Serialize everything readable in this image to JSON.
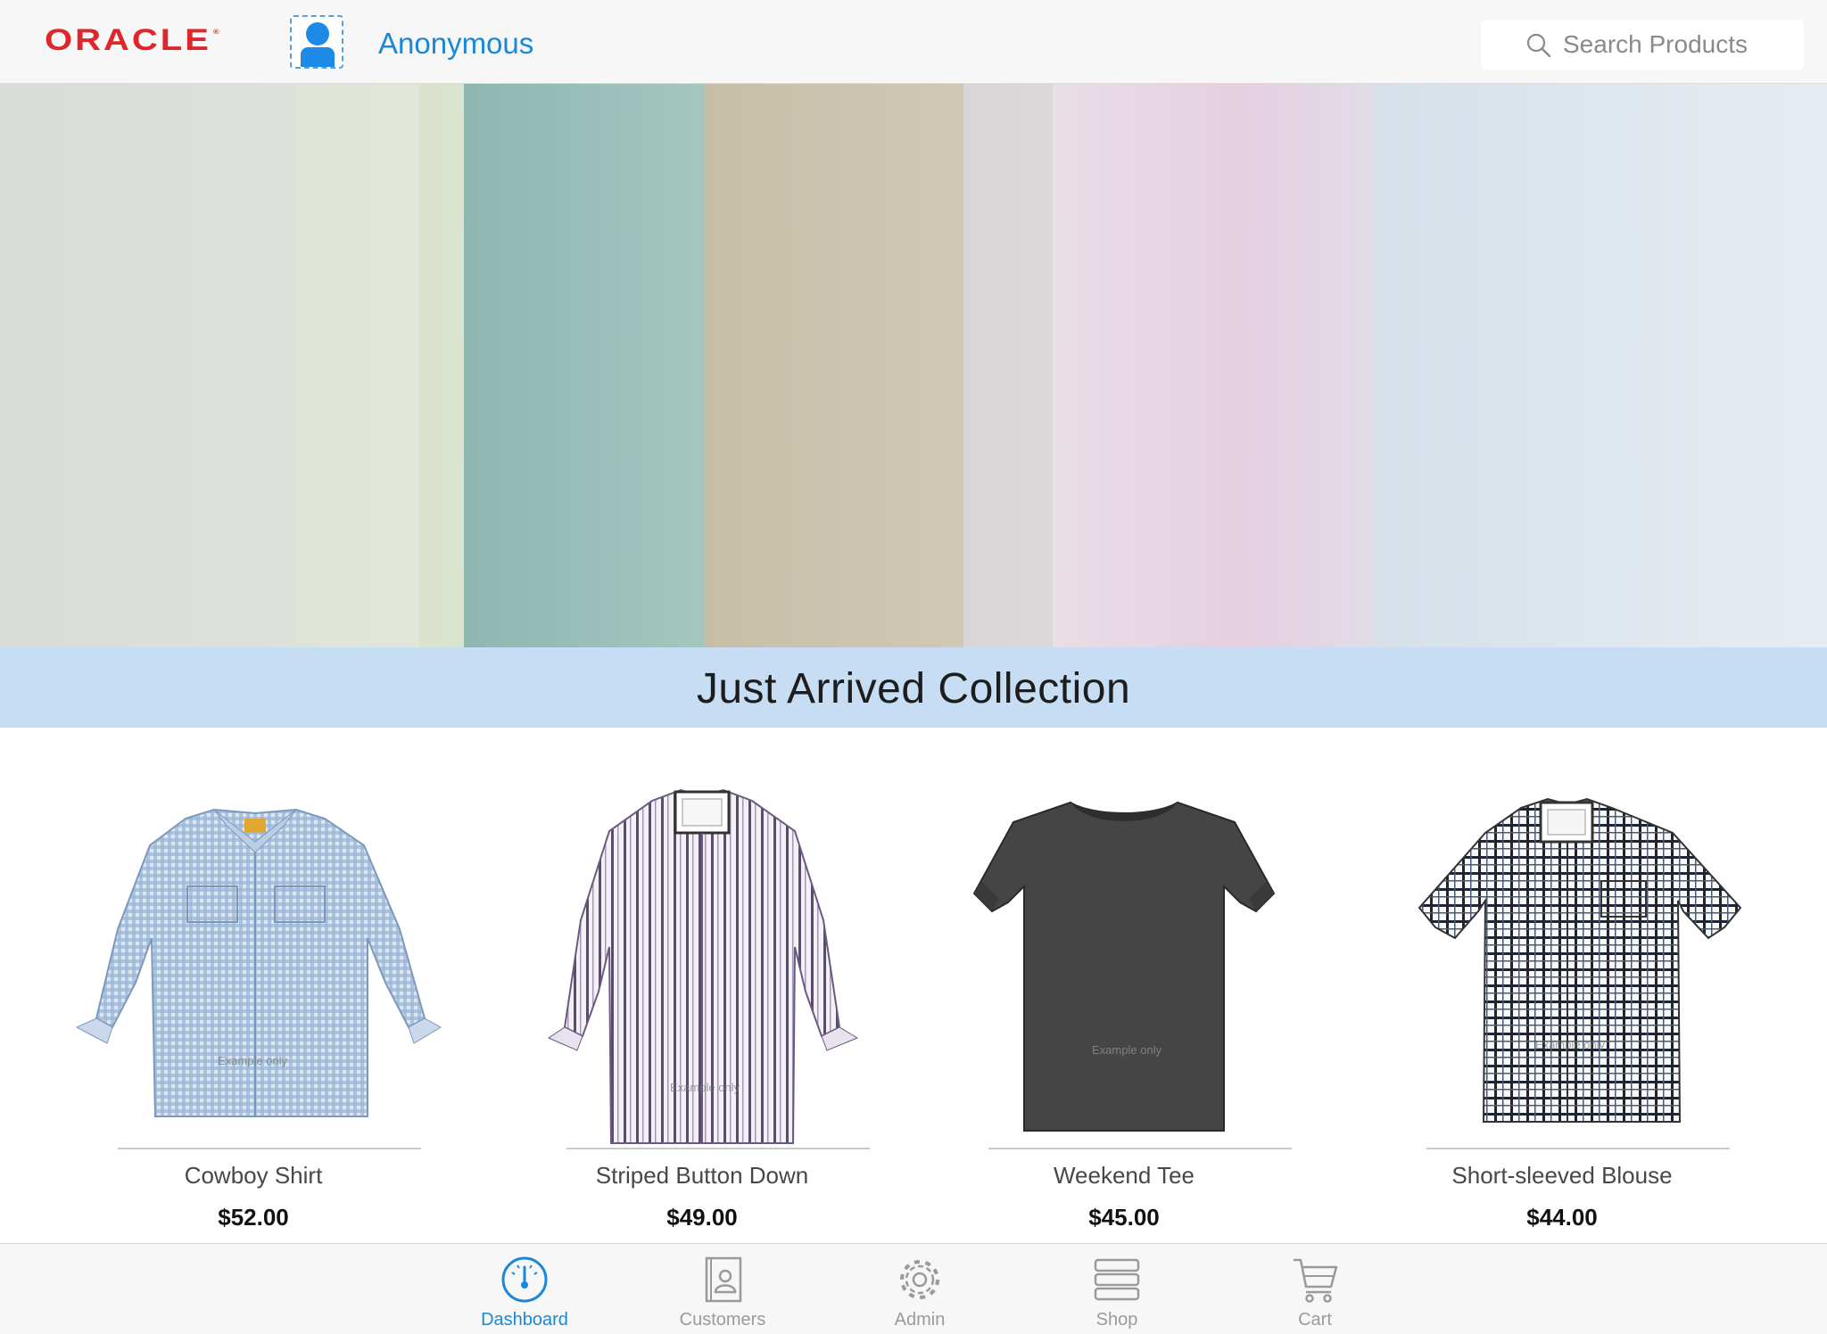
{
  "header": {
    "logo_text": "ORACLE",
    "username": "Anonymous",
    "search_placeholder": "Search Products",
    "brand_color": "#e0262b",
    "accent_color": "#1a88d8"
  },
  "hero": {
    "image": "folded-clothes-on-rack-photo"
  },
  "banner": {
    "title": "Just Arrived Collection",
    "background_color": "#c6ddf3"
  },
  "products": [
    {
      "name": "Cowboy Shirt",
      "price": "$52.00",
      "watermark": "Example only",
      "image": "blue-gingham-long-sleeve-shirt"
    },
    {
      "name": "Striped Button Down",
      "price": "$49.00",
      "watermark": "Example only",
      "image": "purple-striped-long-sleeve-shirt"
    },
    {
      "name": "Weekend Tee",
      "price": "$45.00",
      "watermark": "Example only",
      "image": "charcoal-t-shirt"
    },
    {
      "name": "Short-sleeved Blouse",
      "price": "$44.00",
      "watermark": "Example only",
      "image": "black-plaid-short-sleeve-shirt"
    }
  ],
  "tabs": [
    {
      "label": "Dashboard",
      "icon": "gauge-icon",
      "active": true
    },
    {
      "label": "Customers",
      "icon": "contact-card-icon",
      "active": false
    },
    {
      "label": "Admin",
      "icon": "gear-icon",
      "active": false
    },
    {
      "label": "Shop",
      "icon": "stack-icon",
      "active": false
    },
    {
      "label": "Cart",
      "icon": "cart-icon",
      "active": false
    }
  ]
}
